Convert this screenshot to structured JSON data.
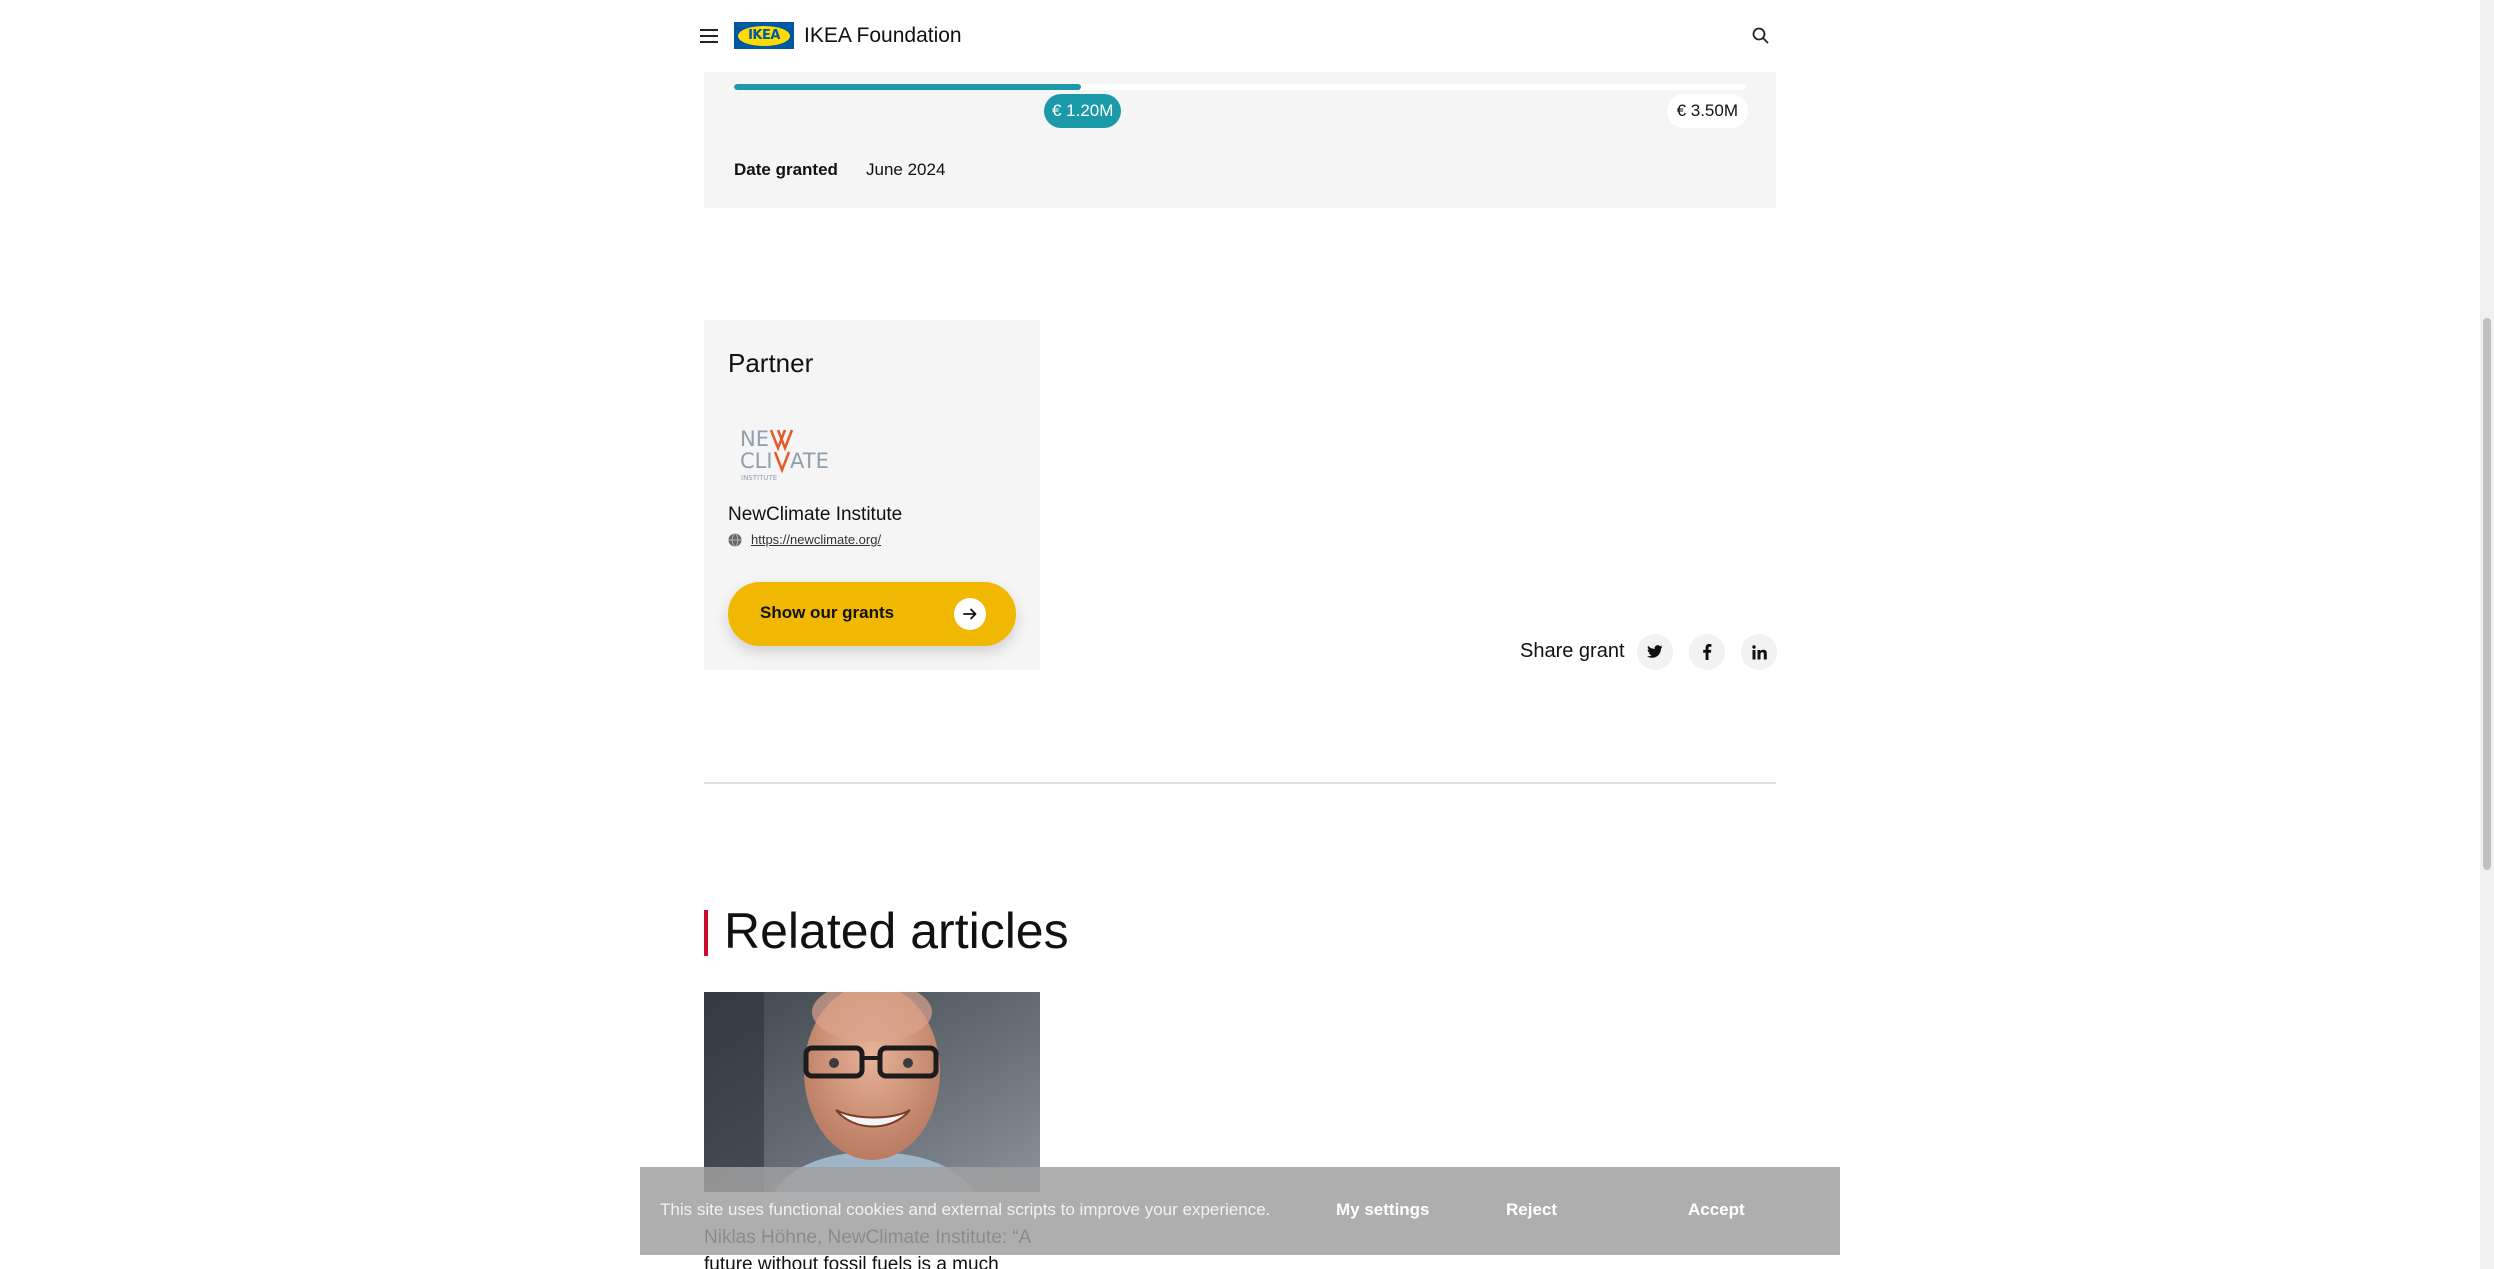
{
  "header": {
    "logo_text": "IKEA",
    "brand": "IKEA Foundation",
    "menu_icon": "hamburger-menu-icon",
    "search_icon": "search-icon"
  },
  "grant": {
    "granted_amount": "€ 1.20M",
    "total_amount": "€ 3.50M",
    "progress_fraction": 0.343,
    "progress_color": "#1a9aa8",
    "date_label": "Date granted",
    "date_value": "June 2024"
  },
  "partner": {
    "title": "Partner",
    "logo_lines": [
      "NEW",
      "CLIMATE",
      "INSTITUTE"
    ],
    "name": "NewClimate Institute",
    "url": "https://newclimate.org/",
    "button_label": "Show our grants",
    "button_color": "#f0b800"
  },
  "share": {
    "label": "Share grant",
    "networks": [
      "twitter-icon",
      "facebook-icon",
      "linkedin-icon"
    ]
  },
  "related": {
    "title": "Related articles",
    "accent_color": "#c8102e",
    "articles": [
      {
        "title": "Niklas Höhne, NewClimate Institute: “A future without fossil fuels is a much"
      }
    ]
  },
  "cookie": {
    "text": "This site uses functional cookies and external scripts to improve your experience.",
    "settings_label": "My settings",
    "reject_label": "Reject",
    "accept_label": "Accept"
  }
}
